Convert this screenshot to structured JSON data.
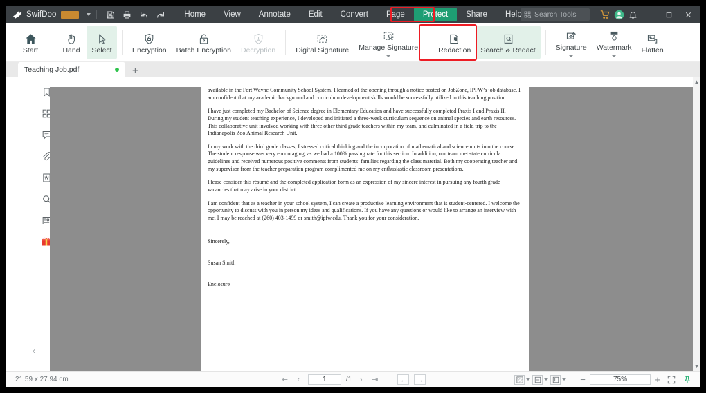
{
  "titlebar": {
    "brand": "SwifDoo",
    "quick_actions": [
      "save-icon",
      "print-icon",
      "undo-icon",
      "redo-icon"
    ],
    "search_placeholder": "Search Tools",
    "tray_icons": [
      "cart-icon",
      "account-icon",
      "bell-icon"
    ],
    "window_controls": [
      "minimize",
      "maximize",
      "close"
    ]
  },
  "menubar": {
    "items": [
      {
        "label": "Home",
        "active": false
      },
      {
        "label": "View",
        "active": false
      },
      {
        "label": "Annotate",
        "active": false
      },
      {
        "label": "Edit",
        "active": false
      },
      {
        "label": "Convert",
        "active": false
      },
      {
        "label": "Page",
        "active": false
      },
      {
        "label": "Protect",
        "active": true
      },
      {
        "label": "Share",
        "active": false
      },
      {
        "label": "Help",
        "active": false
      }
    ],
    "highlight_color": "#ed1c24",
    "active_color": "#1e9e73"
  },
  "ribbon": {
    "groups": [
      {
        "items": [
          {
            "label": "Start",
            "icon": "home-icon",
            "state": "normal"
          }
        ]
      },
      {
        "items": [
          {
            "label": "Hand",
            "icon": "hand-icon",
            "state": "normal"
          },
          {
            "label": "Select",
            "icon": "cursor-icon",
            "state": "selected"
          }
        ]
      },
      {
        "items": [
          {
            "label": "Encryption",
            "icon": "shield-lock-icon",
            "state": "normal"
          },
          {
            "label": "Batch Encryption",
            "icon": "padlock-icon",
            "state": "normal"
          },
          {
            "label": "Decryption",
            "icon": "shield-unlock-icon",
            "state": "disabled"
          }
        ]
      },
      {
        "items": [
          {
            "label": "Digital Signature",
            "icon": "digital-signature-icon",
            "state": "normal"
          },
          {
            "label": "Manage Signature",
            "icon": "manage-signature-icon",
            "state": "normal",
            "dropdown": true
          }
        ]
      },
      {
        "items": [
          {
            "label": "Redaction",
            "icon": "redaction-icon",
            "state": "normal"
          },
          {
            "label": "Search & Redact",
            "icon": "search-redact-icon",
            "state": "selected",
            "annotated": true
          }
        ]
      },
      {
        "items": [
          {
            "label": "Signature",
            "icon": "signature-icon",
            "state": "normal",
            "dropdown": true
          },
          {
            "label": "Watermark",
            "icon": "watermark-icon",
            "state": "normal",
            "dropdown": true
          },
          {
            "label": "Flatten",
            "icon": "flatten-icon",
            "state": "normal"
          }
        ]
      }
    ],
    "selected_bg": "#e2f1e9",
    "annotation_color": "#ed1c24"
  },
  "tabstrip": {
    "document_tab": "Teaching Job.pdf",
    "modified_dot_color": "#2fc34c",
    "new_tab_label": "+"
  },
  "sidebar": {
    "items": [
      {
        "icon": "bookmark-icon",
        "label": "Bookmarks"
      },
      {
        "icon": "thumbnails-icon",
        "label": "Page Thumbnails"
      },
      {
        "icon": "comment-icon",
        "label": "Comments"
      },
      {
        "icon": "attachment-icon",
        "label": "Attachments"
      },
      {
        "icon": "word-doc-icon",
        "label": "Word Document"
      },
      {
        "icon": "search-icon",
        "label": "Search"
      },
      {
        "icon": "stamp-icon",
        "label": "Stamps"
      },
      {
        "icon": "gift-icon",
        "label": "Gift"
      }
    ],
    "collapse_label": "‹"
  },
  "document": {
    "page_badge": "1",
    "paragraphs": [
      "available in the Fort Wayne Community School System. I learned of the opening through a notice posted on JobZone, IPFW’s job database. I am confident that my academic background and curriculum development skills would be successfully utilized in this teaching position.",
      "I have just completed my Bachelor of Science degree in Elementary Education and have successfully completed Praxis I and Praxis II. During my student teaching experience, I developed and initiated a three-week curriculum sequence on animal species and earth resources. This collaborative unit involved working with three other third grade teachers within my team, and culminated in a field trip to the Indianapolis Zoo Animal Research Unit.",
      "In my work with the third grade classes, I stressed critical thinking and the incorporation of mathematical and science units into the course.  The student response was very encouraging, as we had a 100% passing rate for this section.  In addition, our team met state curricula guidelines and received numerous positive comments from students’ families regarding the class material. Both my cooperating teacher and my supervisor from the teacher preparation program complimented me on my enthusiastic classroom presentations.",
      "Please consider this résumé and the completed application form as an expression of my sincere interest in pursuing any fourth grade vacancies that may arise in your district.",
      "I am confident that as a teacher in your school system, I can create a productive learning environment that is student-centered. I welcome the opportunity to discuss with you in person my ideas and qualifications. If you have any questions or would like to arrange an interview with me, I may be reached at (260) 403-1499 or smith@ipfw.edu. Thank you for your consideration."
    ],
    "closing": "Sincerely,",
    "signature_name": "Susan Smith",
    "enclosure": "Enclosure"
  },
  "statusbar": {
    "page_dimensions": "21.59 x 27.94 cm",
    "nav": {
      "first": "⏮",
      "prev": "‹",
      "page_value": "1",
      "page_total": "/1",
      "next": "›",
      "last": "⏭",
      "back": "←",
      "forward": "→"
    },
    "view_modes": [
      "background-mode",
      "single-page-mode",
      "page-layout-mode"
    ],
    "zoom_out": "−",
    "zoom_value": "75%",
    "zoom_in": "+",
    "fit_screen": "fit-screen-icon",
    "pin": "pin-icon",
    "pin_color": "#2fb47a"
  }
}
